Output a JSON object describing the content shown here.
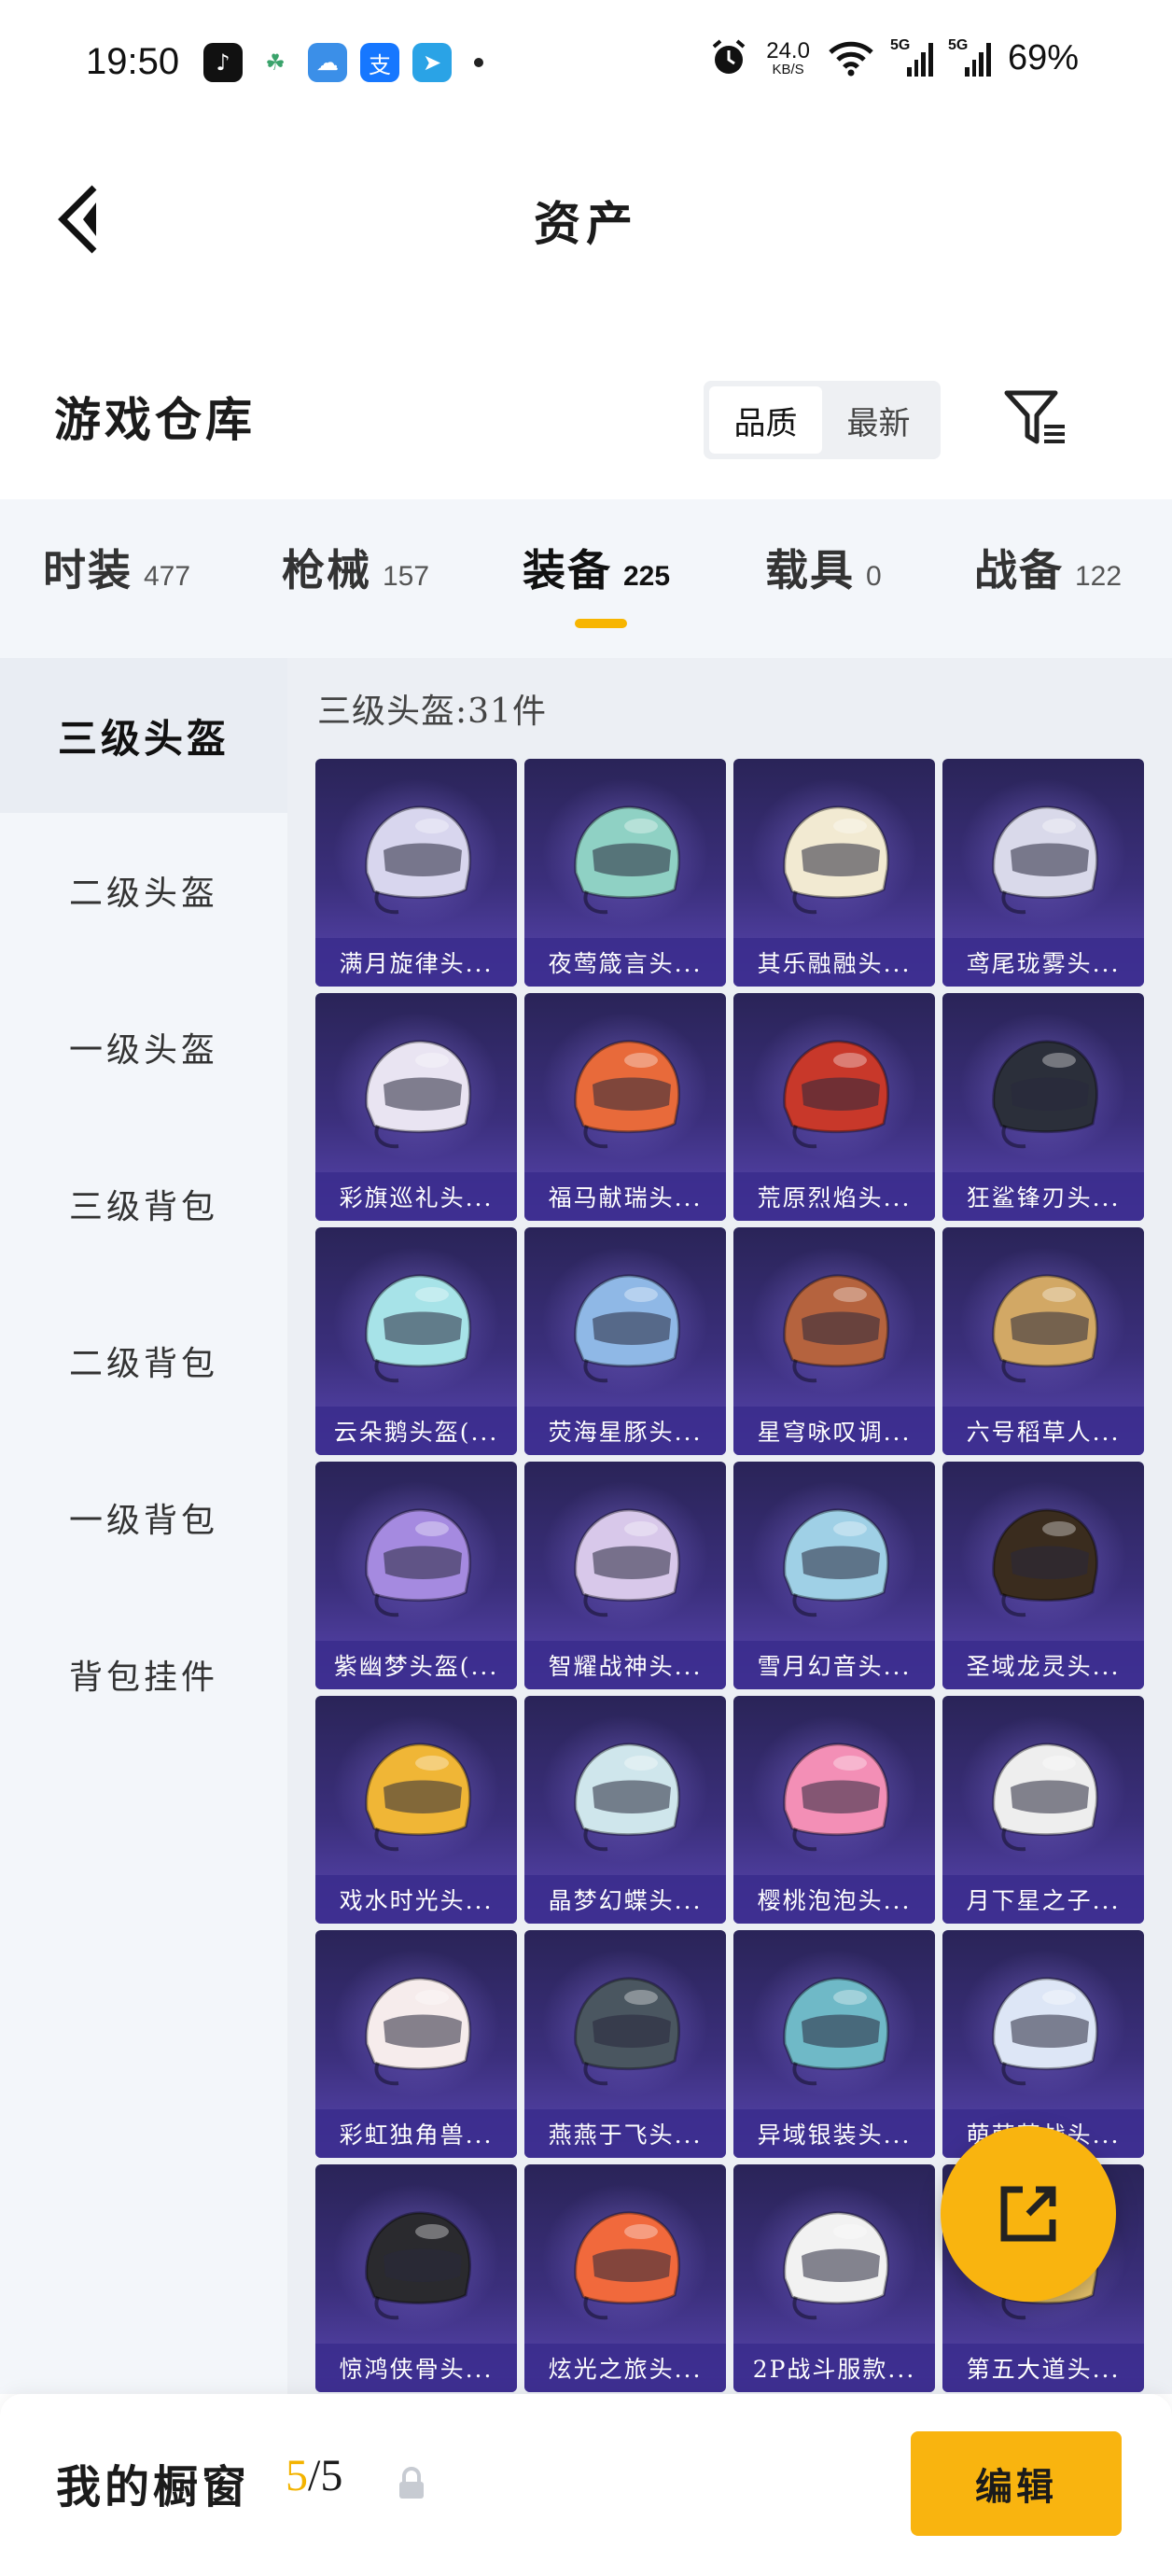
{
  "status_bar": {
    "time": "19:50",
    "net_speed_value": "24.0",
    "net_speed_unit": "KB/S",
    "signal1_label": "5G",
    "signal2_label": "5G",
    "battery": "69%"
  },
  "header": {
    "title": "资产"
  },
  "warehouse": {
    "title": "游戏仓库",
    "sort_options": [
      "品质",
      "最新"
    ],
    "sort_selected": "品质"
  },
  "categories": [
    {
      "name": "时装",
      "count": "477"
    },
    {
      "name": "枪械",
      "count": "157"
    },
    {
      "name": "装备",
      "count": "225",
      "active": true
    },
    {
      "name": "载具",
      "count": "0"
    },
    {
      "name": "战备",
      "count": "122"
    }
  ],
  "subcategories": [
    "三级头盔",
    "二级头盔",
    "一级头盔",
    "三级背包",
    "二级背包",
    "一级背包",
    "背包挂件"
  ],
  "grid": {
    "heading": "三级头盔:31件",
    "items": [
      "满月旋律头...",
      "夜莺箴言头...",
      "其乐融融头...",
      "鸢尾珑雾头...",
      "彩旗巡礼头...",
      "福马献瑞头...",
      "荒原烈焰头...",
      "狂鲨锋刃头...",
      "云朵鹅头盔(...",
      "荧海星豚头...",
      "星穹咏叹调...",
      "六号稻草人...",
      "紫幽梦头盔(...",
      "智耀战神头...",
      "雪月幻音头...",
      "圣域龙灵头...",
      "戏水时光头...",
      "晶梦幻蝶头...",
      "樱桃泡泡头...",
      "月下星之子...",
      "彩虹独角兽...",
      "燕燕于飞头...",
      "异域银装头...",
      "萌萌萌战头...",
      "惊鸿侠骨头...",
      "炫光之旅头...",
      "2P战斗服款...",
      "第五大道头..."
    ],
    "helmet_colors": [
      "#d8d6ee",
      "#8fd1c4",
      "#f2ead2",
      "#d9d9ea",
      "#e9e4f2",
      "#e86a3a",
      "#c8382a",
      "#2b2f3a",
      "#a7e3e8",
      "#8fb8e6",
      "#b5633e",
      "#d2a865",
      "#a58ae0",
      "#d8c8ea",
      "#9fd0e6",
      "#3a2c1e",
      "#f0b636",
      "#cfe6ec",
      "#f38fb6",
      "#eeeeee",
      "#f6ecec",
      "#4a5660",
      "#6fb9c7",
      "#dde6f6",
      "#2a2a2e",
      "#f1693c",
      "#f2f2f2",
      "#e7c36b"
    ]
  },
  "bottom": {
    "title": "我的橱窗",
    "current": "5",
    "total": "/5",
    "edit_label": "编辑"
  }
}
